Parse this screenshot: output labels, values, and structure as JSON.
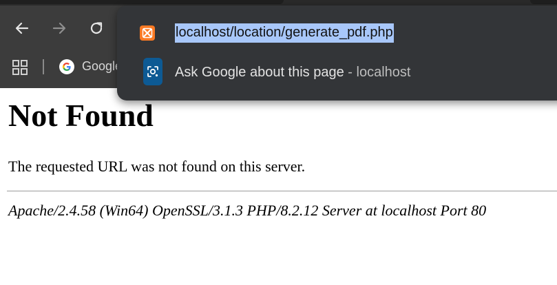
{
  "omnibox": {
    "url": "localhost/location/generate_pdf.php",
    "suggestion_main": "Ask Google about this page",
    "suggestion_sep": " - ",
    "suggestion_host": "localhost"
  },
  "bookmarks": {
    "google_label": "Google"
  },
  "page": {
    "title": "Not Found",
    "message": "The requested URL was not found on this server.",
    "signature": "Apache/2.4.58 (Win64) OpenSSL/3.1.3 PHP/8.2.12 Server at localhost Port 80"
  },
  "icons": {
    "back": "arrow-left-icon",
    "forward": "arrow-right-icon",
    "reload": "reload-icon",
    "apps": "apps-grid-icon",
    "google": "google-logo-icon",
    "xampp": "xampp-logo-icon",
    "lens": "google-lens-icon"
  },
  "colors": {
    "chrome_bg": "#3c3c3c",
    "omnibox_bg": "#333538",
    "selection": "#a8c7fa",
    "xampp": "#fb7a24",
    "lens": "#0d5a94"
  }
}
